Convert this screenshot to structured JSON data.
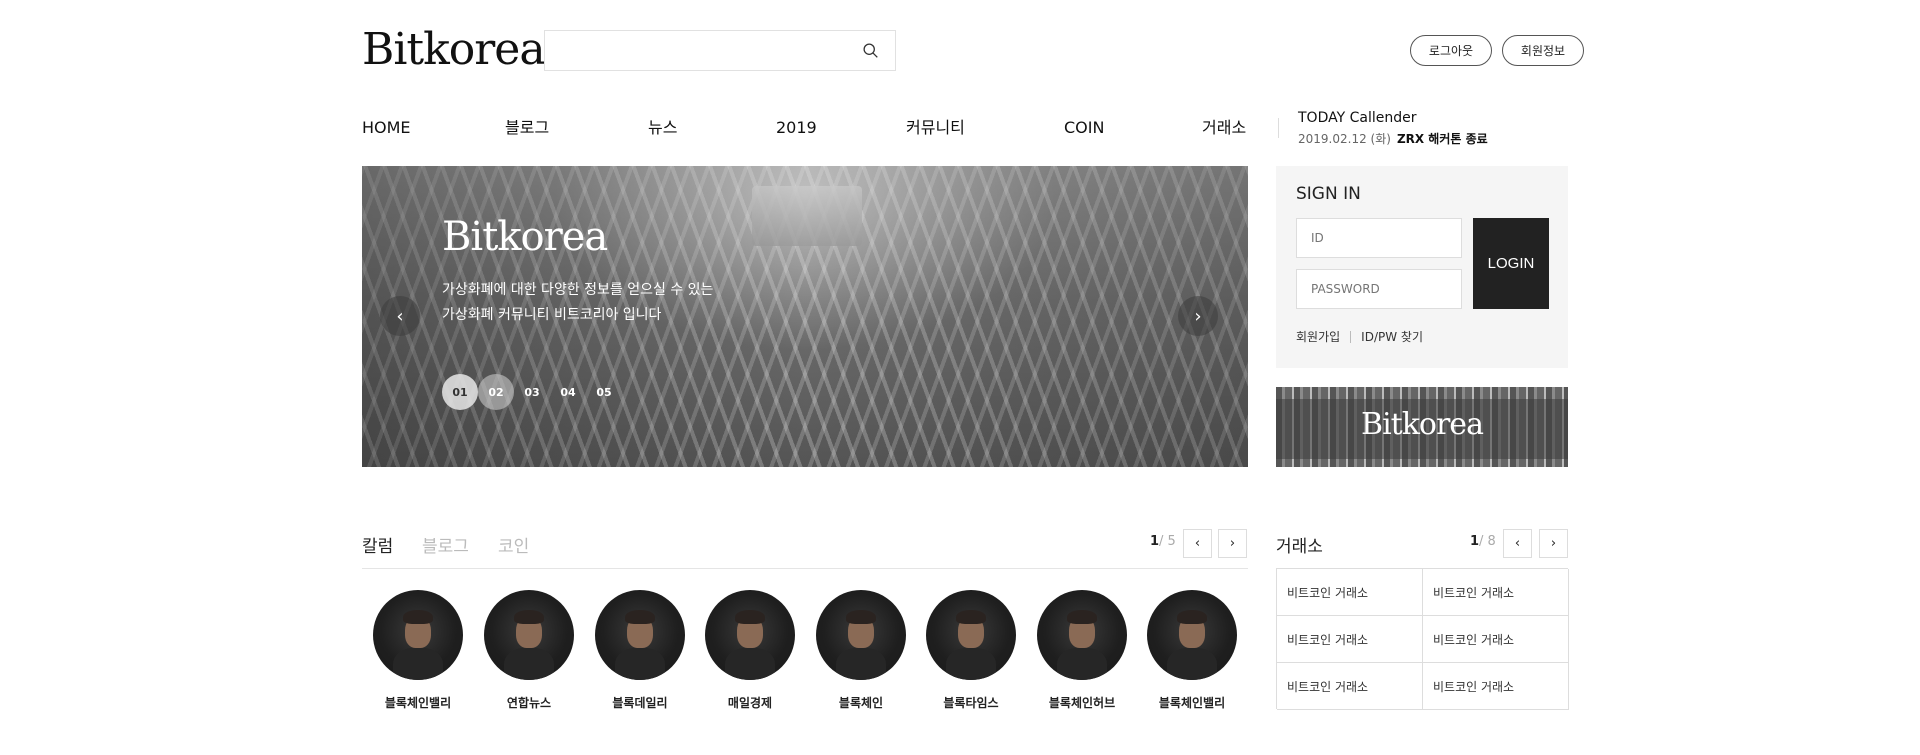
{
  "header": {
    "logo": "Bitkorea",
    "search_placeholder": "",
    "logout_label": "로그아웃",
    "member_info_label": "회원정보"
  },
  "nav": {
    "items": [
      "HOME",
      "블로그",
      "뉴스",
      "2019",
      "커뮤니티",
      "COIN",
      "거래소"
    ]
  },
  "today": {
    "title": "TODAY Callender",
    "date": "2019.02.12 (화)",
    "event": "ZRX 해커톤 종료"
  },
  "hero": {
    "title": "Bitkorea",
    "description": "가상화폐에 대한 다양한 정보를 얻으실 수 있는\n가상화폐 커뮤니티 비트코리아 입니다",
    "prev_icon": "chevron-left-icon",
    "next_icon": "chevron-right-icon",
    "slides": [
      "01",
      "02",
      "03",
      "04",
      "05"
    ],
    "active_slide": "01"
  },
  "signin": {
    "title": "SIGN IN",
    "id_placeholder": "ID",
    "password_placeholder": "PASSWORD",
    "login_label": "LOGIN",
    "join_label": "회원가입",
    "find_label": "ID/PW 찾기"
  },
  "banner": {
    "text": "Bitkorea"
  },
  "column": {
    "tabs": [
      "칼럼",
      "블로그",
      "코인"
    ],
    "active_tab": "칼럼",
    "page_current": "1",
    "page_total": "/ 5",
    "profiles": [
      "블록체인밸리",
      "연합뉴스",
      "블록데일리",
      "매일경제",
      "블록체인",
      "블록타임스",
      "블록체인허브",
      "블록체인밸리"
    ]
  },
  "exchange": {
    "title": "거래소",
    "page_current": "1",
    "page_total": "/ 8",
    "cells": [
      "비트코인 거래소",
      "비트코인 거래소",
      "비트코인 거래소",
      "비트코인 거래소",
      "비트코인 거래소",
      "비트코인 거래소"
    ]
  },
  "icons": {
    "search": "search-icon",
    "pager_prev": "chevron-left-icon",
    "pager_next": "chevron-right-icon"
  }
}
